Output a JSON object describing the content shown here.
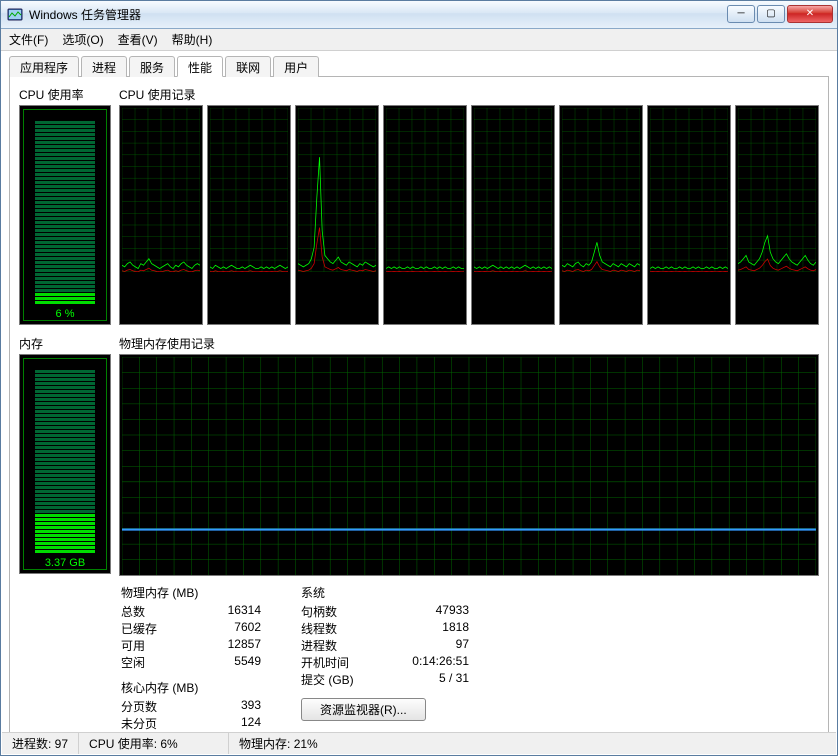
{
  "window": {
    "title": "Windows 任务管理器"
  },
  "menu": {
    "file": "文件(F)",
    "options": "选项(O)",
    "view": "查看(V)",
    "help": "帮助(H)"
  },
  "tabs": {
    "apps": "应用程序",
    "procs": "进程",
    "services": "服务",
    "perf": "性能",
    "net": "联网",
    "users": "用户"
  },
  "labels": {
    "cpu_usage": "CPU 使用率",
    "cpu_history": "CPU 使用记录",
    "memory": "内存",
    "mem_history": "物理内存使用记录",
    "phys_mem": "物理内存 (MB)",
    "total": "总数",
    "cached": "已缓存",
    "available": "可用",
    "free": "空闲",
    "kernel_mem": "核心内存 (MB)",
    "paged": "分页数",
    "nonpaged": "未分页",
    "system": "系统",
    "handles": "句柄数",
    "threads": "线程数",
    "processes": "进程数",
    "uptime": "开机时间",
    "commit": "提交 (GB)",
    "resource_monitor": "资源监视器(R)..."
  },
  "cpu": {
    "percent_text": "6 %",
    "percent": 6
  },
  "mem": {
    "used_text": "3.37 GB",
    "used_ratio": 0.21
  },
  "stats": {
    "phys": {
      "total": "16314",
      "cached": "7602",
      "available": "12857",
      "free": "5549"
    },
    "kernel": {
      "paged": "393",
      "nonpaged": "124"
    },
    "system": {
      "handles": "47933",
      "threads": "1818",
      "processes": "97",
      "uptime": "0:14:26:51",
      "commit": "5 / 31"
    }
  },
  "status": {
    "procs": "进程数: 97",
    "cpu": "CPU 使用率: 6%",
    "mem": "物理内存: 21%"
  },
  "chart_data": {
    "cpu_cores": {
      "type": "line",
      "ylim": [
        0,
        100
      ],
      "ylabel": "%",
      "series": [
        {
          "name": "core0",
          "values": [
            4,
            3,
            5,
            6,
            4,
            3,
            2,
            5,
            4,
            6,
            8,
            5,
            4,
            3,
            2,
            3,
            4,
            5,
            3,
            2,
            4,
            3,
            5,
            6,
            4,
            3,
            2,
            4,
            5,
            4
          ]
        },
        {
          "name": "core1",
          "values": [
            3,
            2,
            4,
            3,
            2,
            3,
            2,
            3,
            4,
            3,
            2,
            2,
            3,
            2,
            3,
            4,
            3,
            2,
            2,
            3,
            2,
            3,
            2,
            3,
            2,
            3,
            4,
            3,
            2,
            3
          ]
        },
        {
          "name": "core2",
          "values": [
            5,
            4,
            3,
            4,
            5,
            8,
            15,
            45,
            70,
            25,
            10,
            8,
            6,
            5,
            7,
            9,
            6,
            5,
            4,
            6,
            5,
            4,
            3,
            5,
            4,
            6,
            5,
            4,
            3,
            4
          ]
        },
        {
          "name": "core3",
          "values": [
            2,
            3,
            2,
            3,
            2,
            3,
            2,
            2,
            3,
            2,
            3,
            2,
            2,
            3,
            2,
            3,
            2,
            2,
            3,
            2,
            3,
            2,
            3,
            2,
            2,
            3,
            2,
            3,
            2,
            2
          ]
        },
        {
          "name": "core4",
          "values": [
            3,
            2,
            3,
            2,
            3,
            2,
            3,
            4,
            3,
            2,
            3,
            2,
            3,
            2,
            3,
            2,
            3,
            2,
            3,
            4,
            3,
            2,
            3,
            2,
            3,
            2,
            3,
            2,
            3,
            2
          ]
        },
        {
          "name": "core5",
          "values": [
            4,
            3,
            5,
            4,
            3,
            5,
            6,
            4,
            3,
            5,
            4,
            6,
            12,
            18,
            10,
            6,
            5,
            4,
            3,
            5,
            4,
            3,
            5,
            4,
            3,
            5,
            4,
            3,
            5,
            4
          ]
        },
        {
          "name": "core6",
          "values": [
            2,
            3,
            2,
            3,
            2,
            2,
            3,
            2,
            3,
            2,
            2,
            3,
            2,
            3,
            2,
            2,
            3,
            2,
            3,
            2,
            2,
            3,
            2,
            3,
            2,
            2,
            3,
            2,
            3,
            2
          ]
        },
        {
          "name": "core7",
          "values": [
            5,
            6,
            8,
            10,
            6,
            5,
            4,
            6,
            8,
            12,
            18,
            22,
            12,
            8,
            6,
            5,
            7,
            9,
            11,
            8,
            6,
            5,
            4,
            6,
            8,
            10,
            7,
            5,
            4,
            6
          ]
        }
      ]
    },
    "mem_history": {
      "type": "line",
      "ylim": [
        0,
        100
      ],
      "ylabel": "%",
      "values": [
        21,
        21,
        21,
        21,
        21,
        21,
        21,
        21,
        21,
        21,
        21,
        21,
        21,
        21,
        21,
        21,
        21,
        21,
        21,
        21,
        21,
        21,
        21,
        21,
        21,
        21,
        21,
        21,
        21,
        21
      ]
    }
  }
}
